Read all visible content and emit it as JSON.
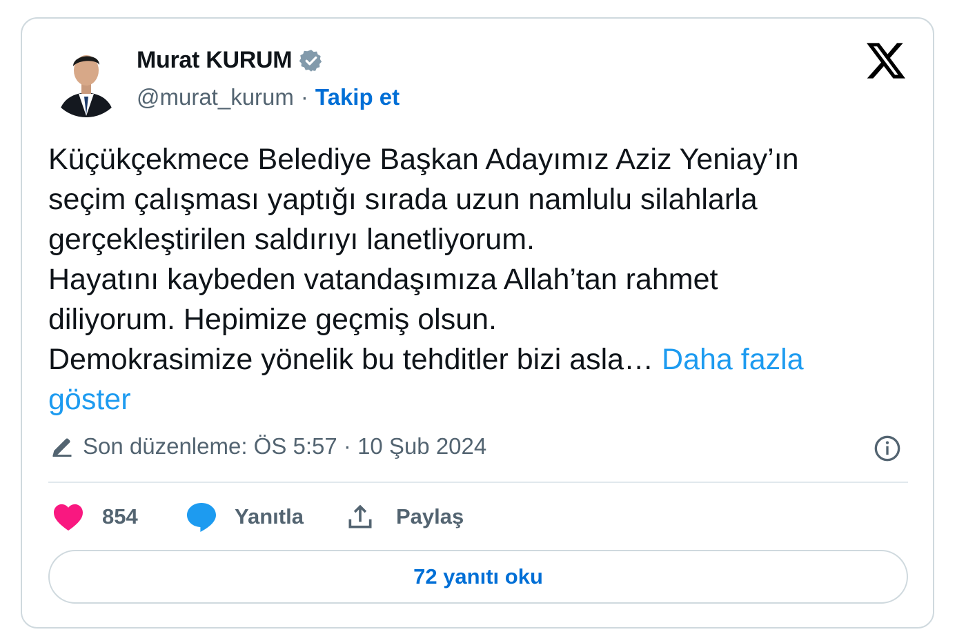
{
  "author": {
    "display_name": "Murat KURUM",
    "handle": "@murat_kurum",
    "separator": "·",
    "follow_label": "Takip et",
    "verified_icon": "verified-badge-icon"
  },
  "tweet": {
    "lines": [
      "Küçükçekmece Belediye Başkan Adayımız Aziz Yeniay’ın",
      "seçim çalışması yaptığı sırada uzun namlulu silahlarla",
      "gerçekleştirilen saldırıyı lanetliyorum.",
      "Hayatını kaybeden vatandaşımıza Allah’tan rahmet",
      "diliyorum. Hepimize geçmiş olsun.",
      "Demokrasimize yönelik bu tehditler bizi asla…"
    ],
    "show_more_part1": "Daha fazla",
    "show_more_part2": "göster"
  },
  "edit_info": {
    "text": "Son düzenleme: ÖS 5:57 · 10 Şub 2024"
  },
  "actions": {
    "like_count": "854",
    "reply_label": "Yanıtla",
    "share_label": "Paylaş"
  },
  "read_replies_label": "72 yanıtı oku",
  "colors": {
    "link_blue": "#006fd6",
    "show_more_blue": "#1d9bf0",
    "like_pink": "#f91880",
    "reply_blue": "#1d9bf0",
    "text_dark": "#0f1419",
    "text_gray": "#536471",
    "verified_gray": "#829aab"
  }
}
